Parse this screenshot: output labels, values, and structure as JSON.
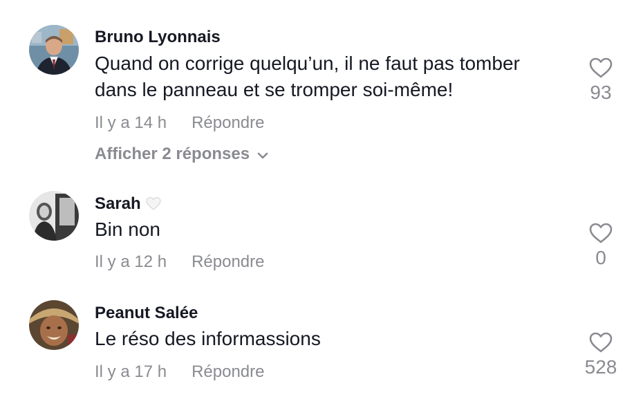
{
  "comments": [
    {
      "username": "Bruno Lyonnais",
      "text": "Quand on corrige quelqu’un, il ne faut pas tomber dans le panneau et se tromper soi-même!",
      "time": "Il y a 14 h",
      "reply_label": "Répondre",
      "likes": "93",
      "view_replies": "Afficher 2 réponses"
    },
    {
      "username": "Sarah",
      "badge_icon": "white-heart-icon",
      "text": "Bin non",
      "time": "Il y a 12 h",
      "reply_label": "Répondre",
      "likes": "0"
    },
    {
      "username": "Peanut Salée",
      "text": "Le réso des informassions",
      "time": "Il y a 17 h",
      "reply_label": "Répondre",
      "likes": "528"
    }
  ],
  "colors": {
    "text": "#161823",
    "secondary": "#8a8b91",
    "background": "#ffffff"
  }
}
